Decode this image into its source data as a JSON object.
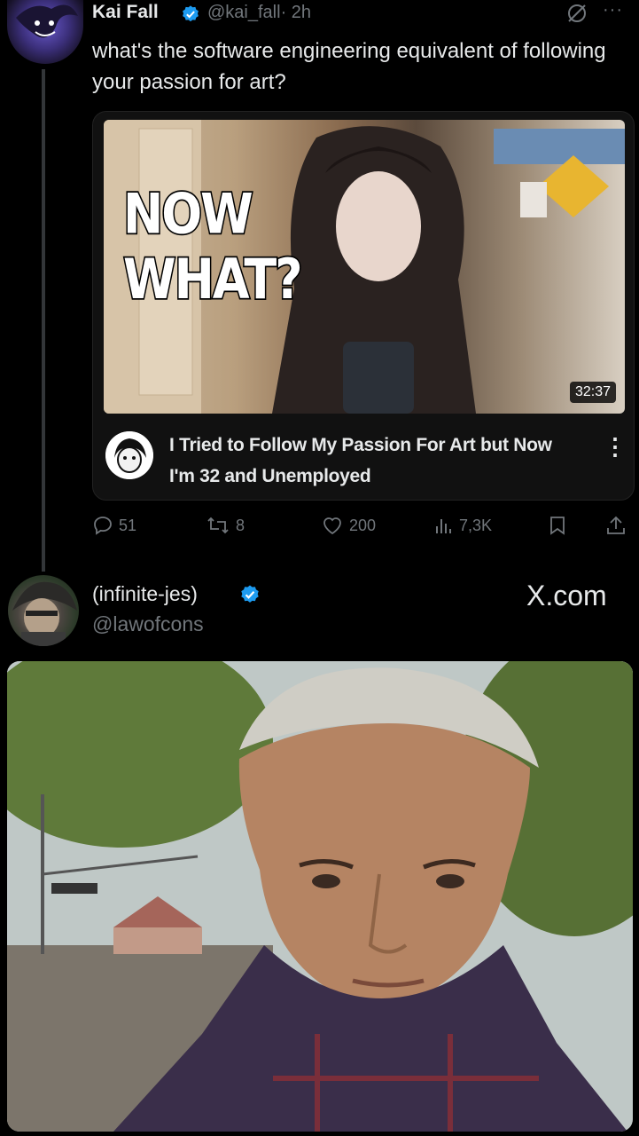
{
  "tweet1": {
    "name": "Kai Fall",
    "handle": "@kai_fall",
    "time": "· 2h",
    "more": "···",
    "text": "what's the software engineering equivalent of following your passion for art?",
    "card": {
      "thumbnail_text_line1": "NOW",
      "thumbnail_text_line2": "WHAT?",
      "duration": "32:37",
      "title": "I Tried to Follow My Passion For Art but Now I'm 32 and Unemployed",
      "menu": "⋮"
    },
    "actions": {
      "replies": "51",
      "reposts": "8",
      "likes": "200",
      "views": "7,3K"
    }
  },
  "tweet2": {
    "name": "(infinite-jes)",
    "handle": "@lawofcons",
    "watermark": "X.com"
  },
  "colors": {
    "background": "#000000",
    "text": "#e7e9ea",
    "muted": "#71767b",
    "verified": "#1d9bf0"
  },
  "icons": [
    "verified-badge-icon",
    "grok-icon",
    "more-icon",
    "reply-icon",
    "repost-icon",
    "like-icon",
    "views-icon",
    "bookmark-icon",
    "share-icon",
    "kebab-menu-icon"
  ]
}
